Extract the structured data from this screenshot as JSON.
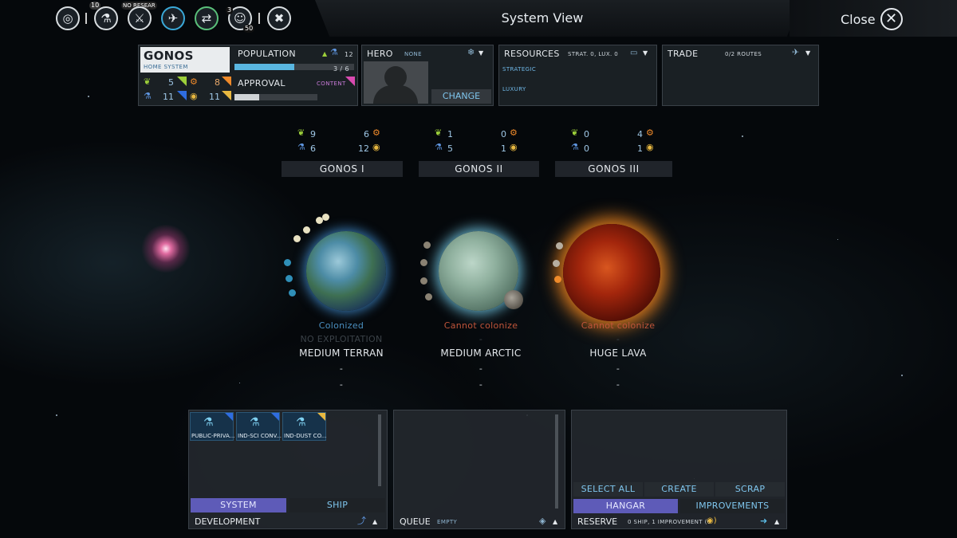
{
  "topbar": {
    "title": "System View",
    "close_label": "Close",
    "research_count": "10",
    "research_text": "NO RESEAR",
    "pop_badge": "3",
    "pop_badge2": "50"
  },
  "system": {
    "name": "GONOS",
    "subtitle": "HOME SYSTEM",
    "food": "5",
    "industry": "8",
    "science": "11",
    "dust": "11"
  },
  "population": {
    "label": "POPULATION",
    "growth": "12",
    "value": "3 / 6",
    "fill": 0.5
  },
  "approval": {
    "label": "APPROVAL",
    "status": "CONTENT",
    "fill": 0.3
  },
  "hero": {
    "label": "HERO",
    "value": "NONE",
    "change_label": "CHANGE"
  },
  "resources": {
    "label": "RESOURCES",
    "summary": "STRAT. 0, LUX. 0",
    "strategic": "STRATEGIC",
    "luxury": "LUXURY"
  },
  "trade": {
    "label": "TRADE",
    "routes": "0/2 ROUTES"
  },
  "planets": [
    {
      "name": "GONOS I",
      "food": "9",
      "industry": "6",
      "science": "6",
      "dust": "12",
      "status": "Colonized",
      "exploitation": "NO EXPLOITATION",
      "type": "MEDIUM TERRAN",
      "line1": "-",
      "line2": "-"
    },
    {
      "name": "GONOS II",
      "food": "1",
      "industry": "0",
      "science": "5",
      "dust": "1",
      "status": "Cannot colonize",
      "exploitation": "-",
      "type": "MEDIUM ARCTIC",
      "line1": "-",
      "line2": "-"
    },
    {
      "name": "GONOS III",
      "food": "0",
      "industry": "4",
      "science": "0",
      "dust": "1",
      "status": "Cannot colonize",
      "exploitation": "-",
      "type": "HUGE LAVA",
      "line1": "-",
      "line2": "-"
    }
  ],
  "development": {
    "label": "DEVELOPMENT",
    "tab_system": "SYSTEM",
    "tab_ship": "SHIP",
    "improvements": [
      "PUBLIC-PRIVA...",
      "IND-SCI CONV...",
      "IND-DUST CO..."
    ]
  },
  "queue": {
    "label": "QUEUE",
    "status": "EMPTY"
  },
  "reserve": {
    "label": "RESERVE",
    "summary": "0 SHIP, 1 IMPROVEMENT (0",
    "select_all": "SELECT ALL",
    "create": "CREATE",
    "scrap": "SCRAP",
    "tab_hangar": "HANGAR",
    "tab_improvements": "IMPROVEMENTS"
  },
  "colors": {
    "accent": "#5e5bb8",
    "science": "#2f6de0",
    "food": "#9ccf3a",
    "industry": "#ef8a2a",
    "dust": "#e8b840",
    "colonized": "#4a8fc0",
    "cannot": "#c0553a"
  }
}
